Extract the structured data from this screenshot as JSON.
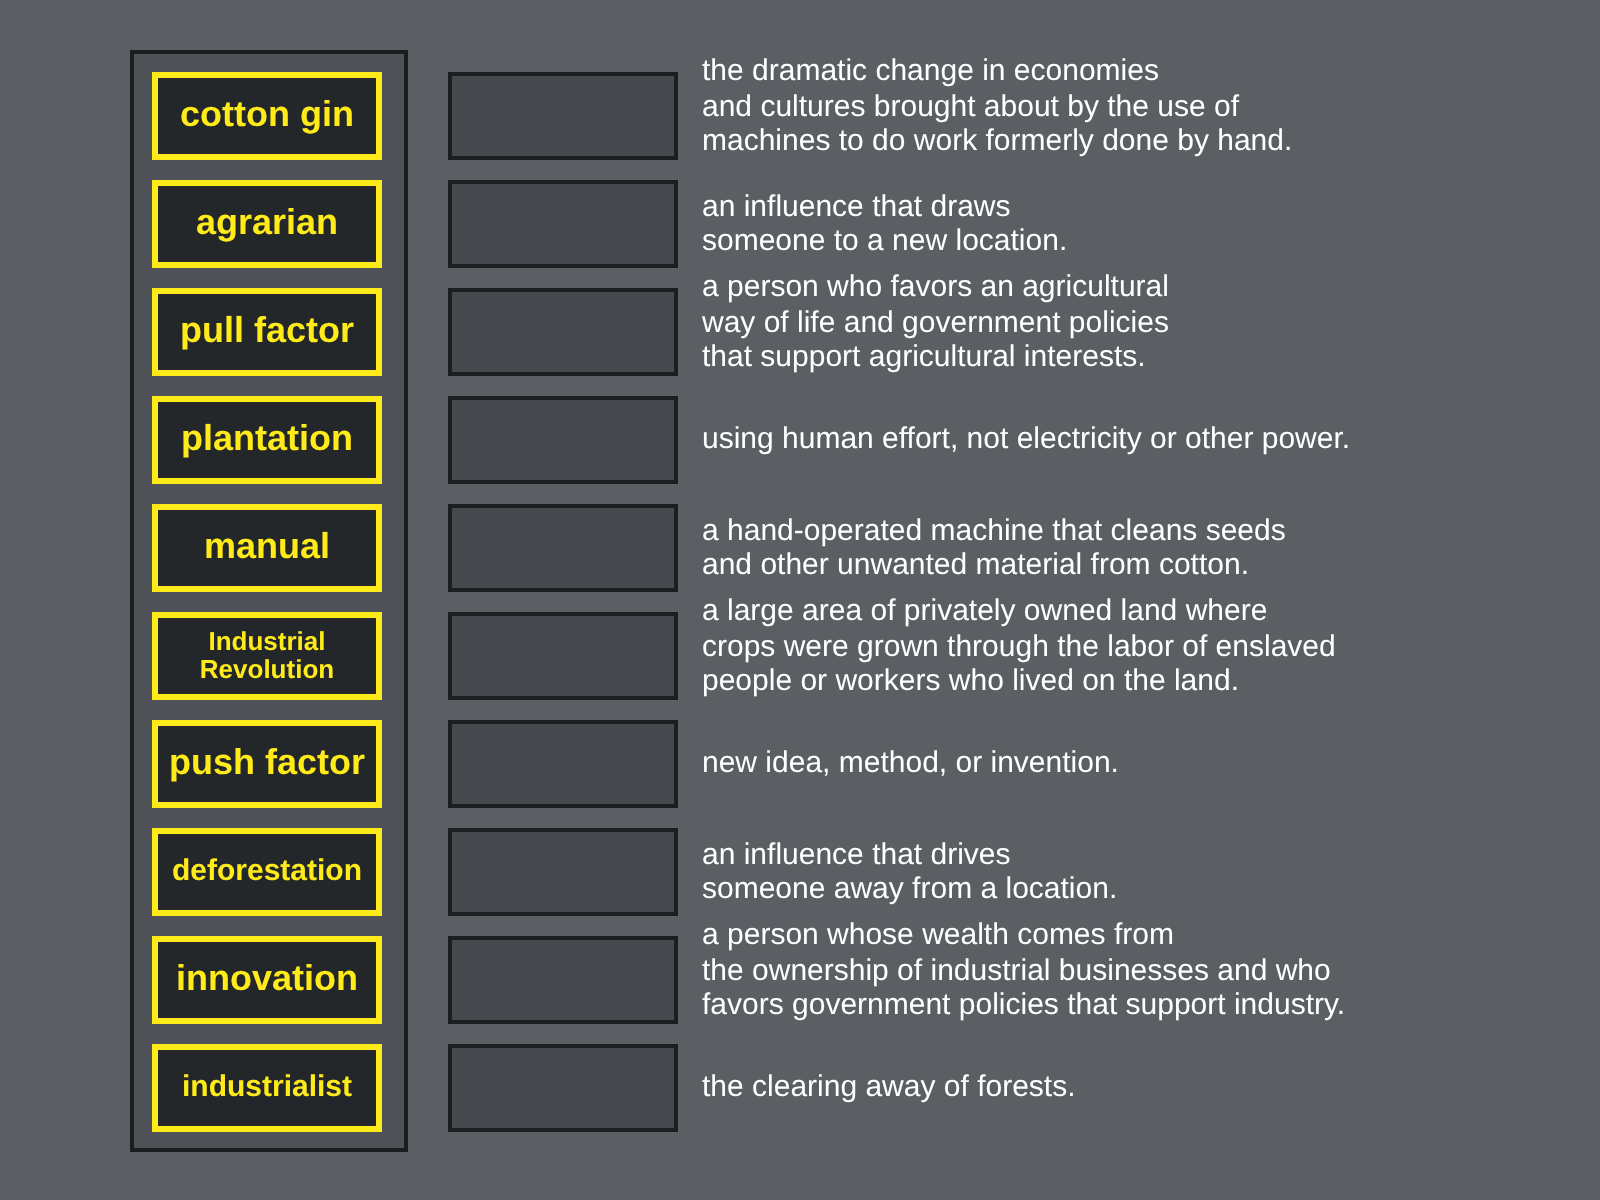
{
  "terms": [
    {
      "label": "cotton gin"
    },
    {
      "label": "agrarian"
    },
    {
      "label": "pull factor"
    },
    {
      "label": "plantation"
    },
    {
      "label": "manual"
    },
    {
      "label": "Industrial Revolution"
    },
    {
      "label": "push factor"
    },
    {
      "label": "deforestation"
    },
    {
      "label": "innovation"
    },
    {
      "label": "industrialist"
    }
  ],
  "definitions": [
    "the dramatic change in economies\nand cultures brought about by the use of\nmachines to do work formerly done by hand.",
    "an influence that draws\nsomeone to a new location.",
    "a person who favors an agricultural\nway of life and government policies\nthat support agricultural interests.",
    "using human effort, not electricity or other power.",
    "a hand-operated machine that cleans seeds\nand other unwanted material from cotton.",
    "a large area of privately owned land where\ncrops were grown through the labor of enslaved\npeople or workers who lived on the land.",
    "new idea, method, or invention.",
    "an influence that drives\nsomeone away from a location.",
    "a person whose wealth comes from\nthe ownership of industrial businesses and who\nfavors government policies that support industry.",
    "the clearing away of forests."
  ]
}
